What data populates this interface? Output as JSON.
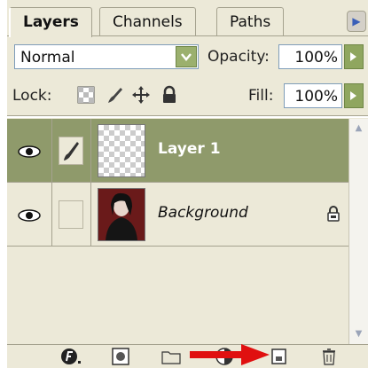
{
  "tabs": [
    {
      "label": "Layers",
      "active": true
    },
    {
      "label": "Channels",
      "active": false
    },
    {
      "label": "Paths",
      "active": false
    }
  ],
  "blend": {
    "mode": "Normal",
    "opacity_label": "Opacity:",
    "opacity_value": "100%"
  },
  "lock": {
    "label": "Lock:",
    "fill_label": "Fill:",
    "fill_value": "100%",
    "icons": [
      "lock-transparent-pixels-icon",
      "lock-image-pixels-icon",
      "lock-position-icon",
      "lock-all-icon"
    ]
  },
  "layers": [
    {
      "name": "Layer 1",
      "selected": true,
      "visible": true,
      "linked_brush": true,
      "thumbnail": "transparent-checkerboard"
    },
    {
      "name": "Background",
      "selected": false,
      "visible": true,
      "linked_brush": false,
      "locked": true,
      "thumbnail": "portrait-photo"
    }
  ],
  "toolbar": {
    "icons": [
      "layer-style-icon",
      "layer-mask-icon",
      "layer-group-icon",
      "adjustment-layer-icon",
      "new-layer-icon",
      "delete-layer-icon"
    ],
    "annotation": "red-arrow-pointing-to-new-layer-icon"
  },
  "colors": {
    "panel_bg": "#ece9d8",
    "selected_row": "#8f9a6b",
    "accent_green": "#8fa65f",
    "annotation_red": "#e01010"
  }
}
